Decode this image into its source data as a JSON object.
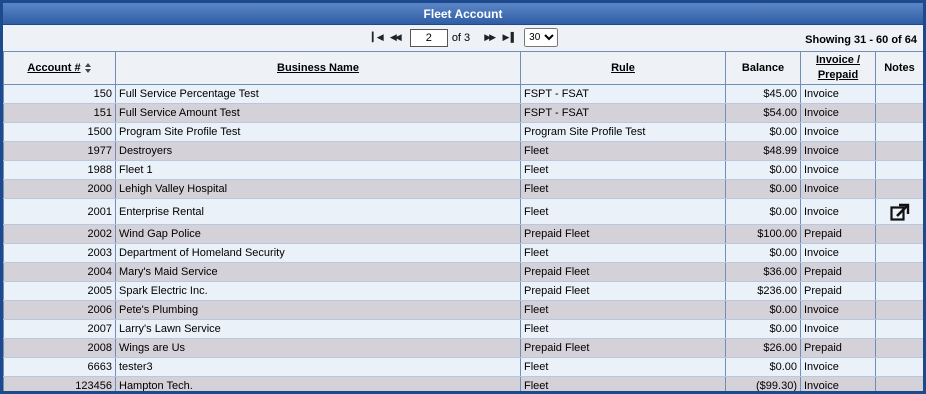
{
  "title": "Fleet Account",
  "pager": {
    "first_icon": "first-page-icon",
    "prev_icon": "previous-page-icon",
    "next_icon": "next-page-icon",
    "last_icon": "last-page-icon",
    "current_page": "2",
    "of_text": "of 3",
    "per_page": "30",
    "per_page_options": [
      "30"
    ],
    "showing": "Showing 31 - 60 of 64"
  },
  "columns": {
    "account": "Account #",
    "business": "Business Name",
    "rule": "Rule",
    "balance": "Balance",
    "invoice_line1": "Invoice /",
    "invoice_line2": "Prepaid",
    "notes": "Notes"
  },
  "rows": [
    {
      "account": "150",
      "business": "Full Service Percentage Test",
      "rule": "FSPT - FSAT",
      "balance": "$45.00",
      "type": "Invoice"
    },
    {
      "account": "151",
      "business": "Full Service Amount Test",
      "rule": "FSPT - FSAT",
      "balance": "$54.00",
      "type": "Invoice"
    },
    {
      "account": "1500",
      "business": "Program Site Profile Test",
      "rule": "Program Site Profile Test",
      "balance": "$0.00",
      "type": "Invoice"
    },
    {
      "account": "1977",
      "business": "Destroyers",
      "rule": "Fleet",
      "balance": "$48.99",
      "type": "Invoice"
    },
    {
      "account": "1988",
      "business": "Fleet 1",
      "rule": "Fleet",
      "balance": "$0.00",
      "type": "Invoice"
    },
    {
      "account": "2000",
      "business": "Lehigh Valley Hospital",
      "rule": "Fleet",
      "balance": "$0.00",
      "type": "Invoice"
    },
    {
      "account": "2001",
      "business": "Enterprise Rental",
      "rule": "Fleet",
      "balance": "$0.00",
      "type": "Invoice",
      "notes_icon": "open-external-icon"
    },
    {
      "account": "2002",
      "business": "Wind Gap Police",
      "rule": "Prepaid Fleet",
      "balance": "$100.00",
      "type": "Prepaid"
    },
    {
      "account": "2003",
      "business": "Department of Homeland Security",
      "rule": "Fleet",
      "balance": "$0.00",
      "type": "Invoice"
    },
    {
      "account": "2004",
      "business": "Mary's Maid Service",
      "rule": "Prepaid Fleet",
      "balance": "$36.00",
      "type": "Prepaid"
    },
    {
      "account": "2005",
      "business": "Spark Electric Inc.",
      "rule": "Prepaid Fleet",
      "balance": "$236.00",
      "type": "Prepaid"
    },
    {
      "account": "2006",
      "business": "Pete's Plumbing",
      "rule": "Fleet",
      "balance": "$0.00",
      "type": "Invoice"
    },
    {
      "account": "2007",
      "business": "Larry's Lawn Service",
      "rule": "Fleet",
      "balance": "$0.00",
      "type": "Invoice"
    },
    {
      "account": "2008",
      "business": "Wings are Us",
      "rule": "Prepaid Fleet",
      "balance": "$26.00",
      "type": "Prepaid"
    },
    {
      "account": "6663",
      "business": "tester3",
      "rule": "Fleet",
      "balance": "$0.00",
      "type": "Invoice"
    },
    {
      "account": "123456",
      "business": "Hampton Tech.",
      "rule": "Fleet",
      "balance": "($99.30)",
      "type": "Invoice"
    }
  ]
}
